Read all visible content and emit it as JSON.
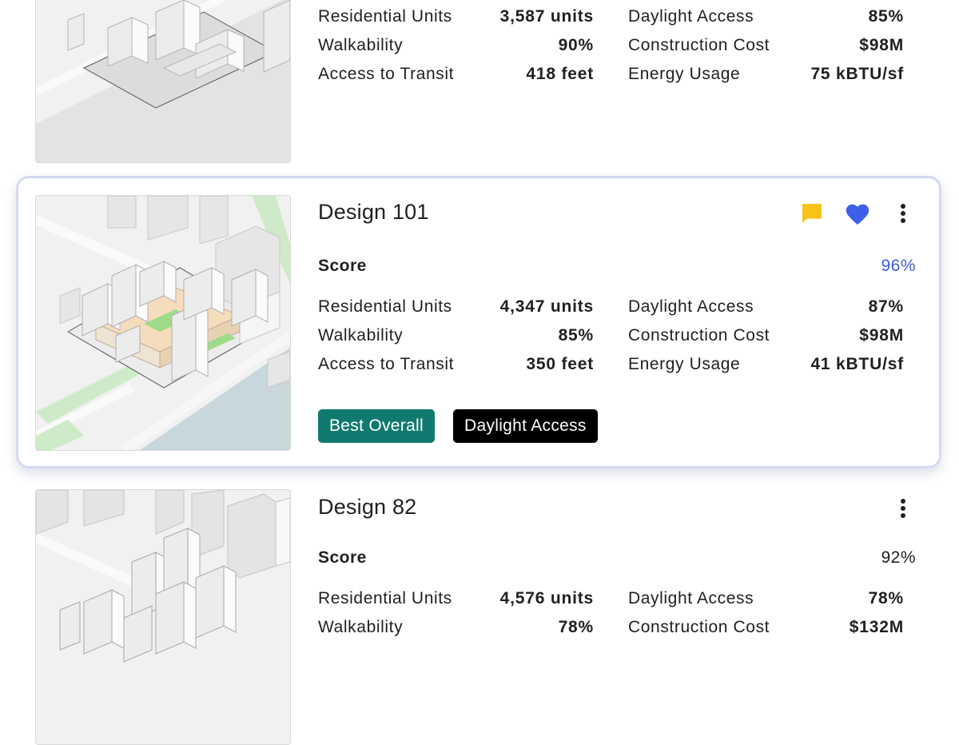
{
  "colors": {
    "accent_blue": "#3b5bdb",
    "tag_best": "#117a6e",
    "tag_dark": "#000000",
    "comment_yellow": "#f9c318",
    "heart_blue": "#3e5fe8"
  },
  "designs": [
    {
      "metrics_left": [
        {
          "label": "Residential Units",
          "value": "3,587 units"
        },
        {
          "label": "Walkability",
          "value": "90%"
        },
        {
          "label": "Access to Transit",
          "value": "418 feet"
        }
      ],
      "metrics_right": [
        {
          "label": "Daylight Access",
          "value": "85%"
        },
        {
          "label": "Construction Cost",
          "value": "$98M"
        },
        {
          "label": "Energy Usage",
          "value": "75 kBTU/sf"
        }
      ]
    },
    {
      "title": "Design 101",
      "score_label": "Score",
      "score_value": "96%",
      "favorited": true,
      "icons": [
        "comment-icon",
        "heart-icon",
        "more-vert-icon"
      ],
      "metrics_left": [
        {
          "label": "Residential Units",
          "value": "4,347 units"
        },
        {
          "label": "Walkability",
          "value": "85%"
        },
        {
          "label": "Access to Transit",
          "value": "350 feet"
        }
      ],
      "metrics_right": [
        {
          "label": "Daylight Access",
          "value": "87%"
        },
        {
          "label": "Construction Cost",
          "value": "$98M"
        },
        {
          "label": "Energy Usage",
          "value": "41 kBTU/sf"
        }
      ],
      "tags": [
        "Best Overall",
        "Daylight Access"
      ]
    },
    {
      "title": "Design 82",
      "score_label": "Score",
      "score_value": "92%",
      "icons": [
        "more-vert-icon"
      ],
      "metrics_left": [
        {
          "label": "Residential Units",
          "value": "4,576 units"
        },
        {
          "label": "Walkability",
          "value": "78%"
        }
      ],
      "metrics_right": [
        {
          "label": "Daylight Access",
          "value": "78%"
        },
        {
          "label": "Construction Cost",
          "value": "$132M"
        }
      ]
    }
  ]
}
